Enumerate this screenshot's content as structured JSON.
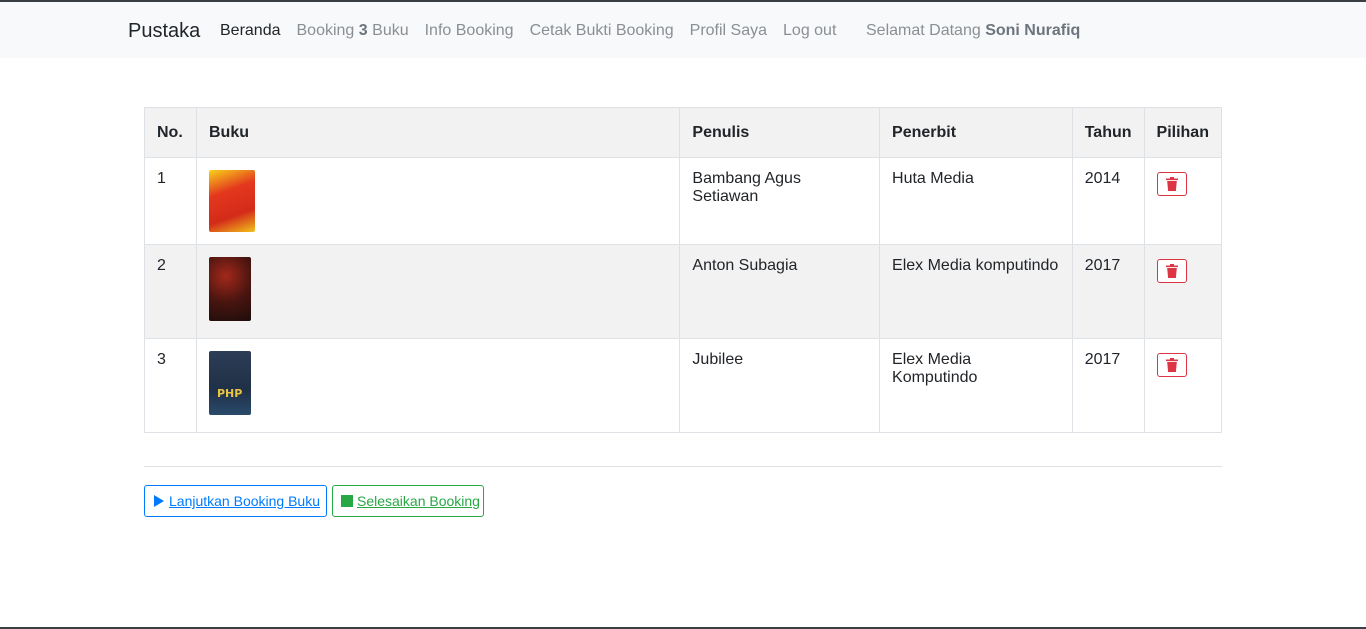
{
  "navbar": {
    "brand": "Pustaka",
    "items": [
      {
        "label": "Beranda"
      },
      {
        "label_prefix": "Booking",
        "count": "3",
        "label_suffix": "Buku"
      },
      {
        "label": "Info Booking"
      },
      {
        "label": "Cetak Bukti Booking"
      },
      {
        "label": "Profil Saya"
      },
      {
        "label": "Log out"
      }
    ],
    "welcome_prefix": "Selamat Datang",
    "user_name": "Soni Nurafiq"
  },
  "table": {
    "headers": [
      "No.",
      "Buku",
      "Penulis",
      "Penerbit",
      "Tahun",
      "Pilihan"
    ],
    "rows": [
      {
        "no": "1",
        "penulis": "Bambang Agus Setiawan",
        "penerbit": "Huta Media",
        "tahun": "2014"
      },
      {
        "no": "2",
        "penulis": "Anton Subagia",
        "penerbit": "Elex Media komputindo",
        "tahun": "2017"
      },
      {
        "no": "3",
        "penulis": "Jubilee",
        "penerbit": "Elex Media Komputindo",
        "tahun": "2017"
      }
    ]
  },
  "actions": {
    "continue_label": "Lanjutkan Booking Buku",
    "finish_label": "Selesaikan Booking"
  },
  "colors": {
    "danger": "#dc3545",
    "primary": "#007bff",
    "success": "#28a745"
  },
  "icons": {
    "delete": "trash-icon",
    "continue": "play-icon",
    "finish": "stop-icon"
  }
}
